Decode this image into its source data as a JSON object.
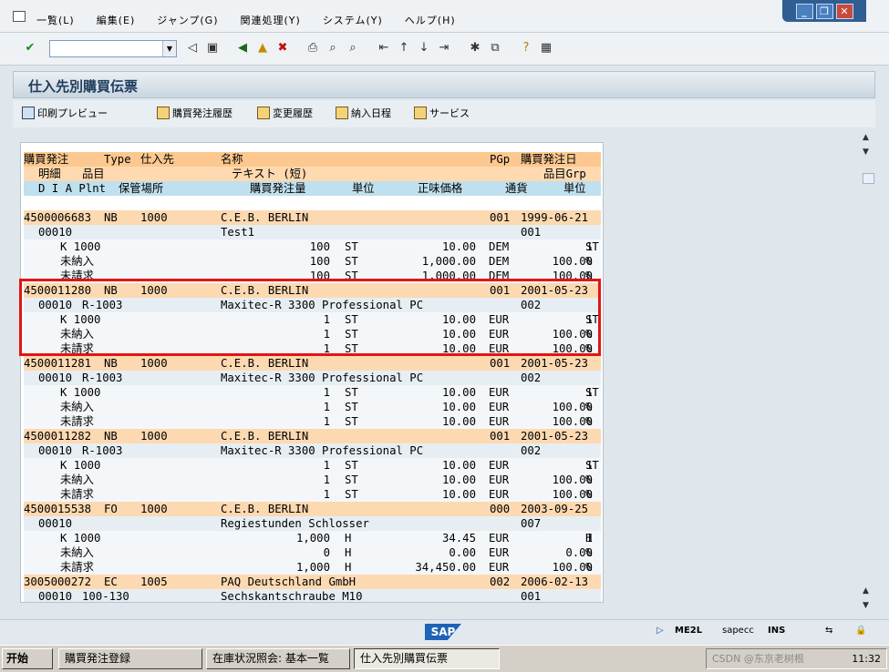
{
  "menu": {
    "items": [
      "一覧(L)",
      "編集(E)",
      "ジャンプ(G)",
      "関連処理(Y)",
      "システム(Y)",
      "ヘルプ(H)"
    ]
  },
  "window_controls": {
    "minimize": "_",
    "restore": "❐",
    "close": "✕"
  },
  "command_field": {
    "value": "",
    "placeholder": ""
  },
  "screen": {
    "title": "仕入先別購買伝票"
  },
  "app_toolbar": {
    "print_preview": "印刷プレビュー",
    "po_history": "購買発注履歴",
    "change_history": "変更履歴",
    "delivery_schedule": "納入日程",
    "services": "サービス"
  },
  "list": {
    "header1": [
      "購買発注",
      "Type",
      "仕入先",
      "名称",
      "PGp",
      "購買発注日"
    ],
    "header2": [
      "明細",
      "品目",
      "テキスト (短)",
      "品目Grp"
    ],
    "header3": [
      "D I A Plnt",
      "保管場所",
      "購買発注量",
      "単位",
      "正味価格",
      "通貨",
      "単位"
    ],
    "documents": [
      {
        "po": "4500006683",
        "type": "NB",
        "vendor": "1000",
        "name": "C.E.B. BERLIN",
        "pgp": "001",
        "date": "1999-06-21",
        "item": {
          "no": "00010",
          "material": "",
          "text": "Test1",
          "grp": "001"
        },
        "lines": [
          {
            "label": "K 1000",
            "qty": "100",
            "unit": "ST",
            "price": "10.00",
            "cur": "DEM",
            "per": "1",
            "pu": "ST"
          },
          {
            "label": "未納入",
            "qty": "100",
            "unit": "ST",
            "price": "1,000.00",
            "cur": "DEM",
            "per": "100.00",
            "pu": "%"
          },
          {
            "label": "未請求",
            "qty": "100",
            "unit": "ST",
            "price": "1,000.00",
            "cur": "DEM",
            "per": "100.00",
            "pu": "%"
          }
        ]
      },
      {
        "po": "4500011280",
        "type": "NB",
        "vendor": "1000",
        "name": "C.E.B. BERLIN",
        "pgp": "001",
        "date": "2001-05-23",
        "item": {
          "no": "00010",
          "material": "R-1003",
          "text": "Maxitec-R 3300 Professional PC",
          "grp": "002"
        },
        "lines": [
          {
            "label": "K 1000",
            "qty": "1",
            "unit": "ST",
            "price": "10.00",
            "cur": "EUR",
            "per": "1",
            "pu": "ST"
          },
          {
            "label": "未納入",
            "qty": "1",
            "unit": "ST",
            "price": "10.00",
            "cur": "EUR",
            "per": "100.00",
            "pu": "%"
          },
          {
            "label": "未請求",
            "qty": "1",
            "unit": "ST",
            "price": "10.00",
            "cur": "EUR",
            "per": "100.00",
            "pu": "%"
          }
        ]
      },
      {
        "po": "4500011281",
        "type": "NB",
        "vendor": "1000",
        "name": "C.E.B. BERLIN",
        "pgp": "001",
        "date": "2001-05-23",
        "item": {
          "no": "00010",
          "material": "R-1003",
          "text": "Maxitec-R 3300 Professional PC",
          "grp": "002"
        },
        "lines": [
          {
            "label": "K 1000",
            "qty": "1",
            "unit": "ST",
            "price": "10.00",
            "cur": "EUR",
            "per": "1",
            "pu": "ST"
          },
          {
            "label": "未納入",
            "qty": "1",
            "unit": "ST",
            "price": "10.00",
            "cur": "EUR",
            "per": "100.00",
            "pu": "%"
          },
          {
            "label": "未請求",
            "qty": "1",
            "unit": "ST",
            "price": "10.00",
            "cur": "EUR",
            "per": "100.00",
            "pu": "%"
          }
        ]
      },
      {
        "po": "4500011282",
        "type": "NB",
        "vendor": "1000",
        "name": "C.E.B. BERLIN",
        "pgp": "001",
        "date": "2001-05-23",
        "item": {
          "no": "00010",
          "material": "R-1003",
          "text": "Maxitec-R 3300 Professional PC",
          "grp": "002"
        },
        "lines": [
          {
            "label": "K 1000",
            "qty": "1",
            "unit": "ST",
            "price": "10.00",
            "cur": "EUR",
            "per": "1",
            "pu": "ST"
          },
          {
            "label": "未納入",
            "qty": "1",
            "unit": "ST",
            "price": "10.00",
            "cur": "EUR",
            "per": "100.00",
            "pu": "%"
          },
          {
            "label": "未請求",
            "qty": "1",
            "unit": "ST",
            "price": "10.00",
            "cur": "EUR",
            "per": "100.00",
            "pu": "%"
          }
        ]
      },
      {
        "po": "4500015538",
        "type": "FO",
        "vendor": "1000",
        "name": "C.E.B. BERLIN",
        "pgp": "000",
        "date": "2003-09-25",
        "item": {
          "no": "00010",
          "material": "",
          "text": "Regiestunden Schlosser",
          "grp": "007"
        },
        "lines": [
          {
            "label": "K 1000",
            "qty": "1,000",
            "unit": "H",
            "price": "34.45",
            "cur": "EUR",
            "per": "1",
            "pu": "H"
          },
          {
            "label": "未納入",
            "qty": "0",
            "unit": "H",
            "price": "0.00",
            "cur": "EUR",
            "per": "0.00",
            "pu": "%"
          },
          {
            "label": "未請求",
            "qty": "1,000",
            "unit": "H",
            "price": "34,450.00",
            "cur": "EUR",
            "per": "100.00",
            "pu": "%"
          }
        ]
      },
      {
        "po": "3005000272",
        "type": "EC",
        "vendor": "1005",
        "name": "PAQ Deutschland GmbH",
        "pgp": "002",
        "date": "2006-02-13",
        "item": {
          "no": "00010",
          "material": "100-130",
          "text": "Sechskantschraube M10",
          "grp": "001"
        },
        "lines": []
      }
    ]
  },
  "status": {
    "tcode": "ME2L",
    "server": "sapecc",
    "mode": "INS"
  },
  "taskbar": {
    "start": "开始",
    "tasks": [
      "購買発注登録",
      "在庫状況照会: 基本一覧",
      "仕入先別購買伝票"
    ],
    "clock": "11:32",
    "watermark": "CSDN @东京老树根"
  }
}
